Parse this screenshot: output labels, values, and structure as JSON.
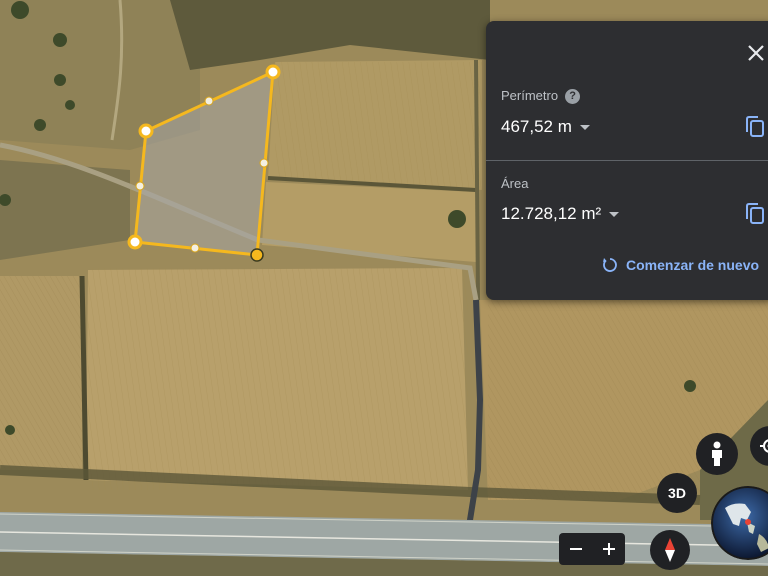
{
  "measurement_panel": {
    "perimeter_label": "Perímetro",
    "help_symbol": "?",
    "perimeter_value": "467,52 m",
    "area_label": "Área",
    "area_value": "12.728,12 m²",
    "restart_label": "Comenzar de nuevo"
  },
  "controls": {
    "three_d_label": "3D",
    "zoom_out": "−",
    "zoom_in": "+"
  },
  "colors": {
    "polygon_stroke": "#f5b81e",
    "panel_background": "#2d2e31",
    "accent_link": "#8ab4f8"
  },
  "icons": [
    "close-icon",
    "help-icon",
    "copy-icon",
    "restart-icon",
    "pegman-icon",
    "locate-icon",
    "compass-icon",
    "globe-icon"
  ]
}
